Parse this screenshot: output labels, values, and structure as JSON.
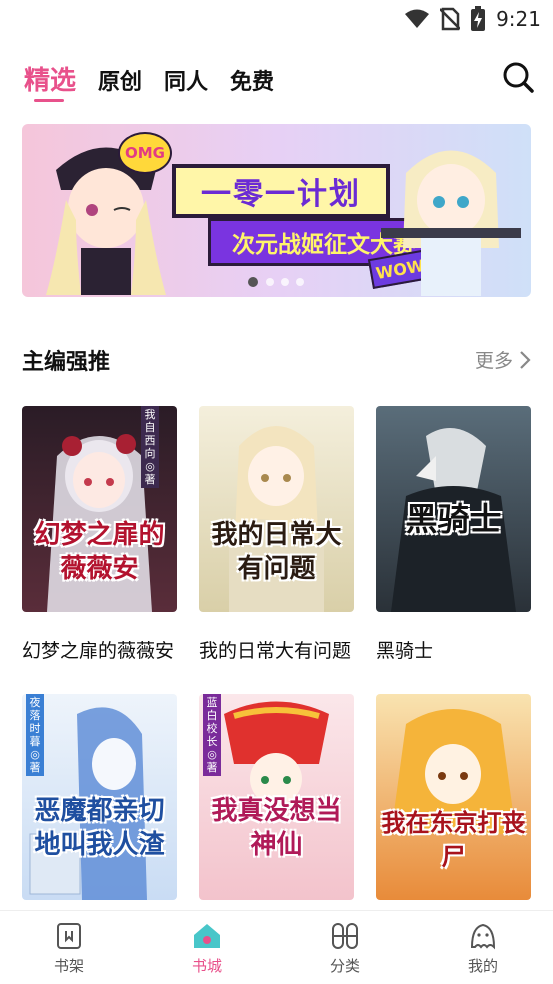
{
  "status": {
    "time": "9:21"
  },
  "tabs": [
    {
      "label": "精选",
      "active": true
    },
    {
      "label": "原创",
      "active": false
    },
    {
      "label": "同人",
      "active": false
    },
    {
      "label": "免费",
      "active": false
    }
  ],
  "banner": {
    "title": "一零一计划",
    "subtitle": "次元战姬征文大赛",
    "badge_omg": "OMG",
    "badge_wow": "WOW",
    "page_count": 4,
    "active_page": 1
  },
  "section": {
    "title": "主编强推",
    "more_label": "更多"
  },
  "books": [
    {
      "name": "幻梦之扉的薇薇安",
      "cover_text": "幻梦之扉的薇薇安",
      "author_tag": "我自西向◎著",
      "bg": "#3b2a33"
    },
    {
      "name": "我的日常大有问题",
      "cover_text": "我的日常大有问题",
      "author_tag": "",
      "bg": "#e9e2c8"
    },
    {
      "name": "黑骑士",
      "cover_text": "黑骑士",
      "author_tag": "",
      "bg": "#3c4a55"
    },
    {
      "name": "",
      "cover_text": "恶魔都亲切地叫我人渣",
      "author_tag": "夜落时暮◎著",
      "bg": "#dde9f8"
    },
    {
      "name": "",
      "cover_text": "我真没想当神仙",
      "author_tag": "蓝白校长◎著",
      "bg": "#f6d6dc"
    },
    {
      "name": "",
      "cover_text": "我在东京打丧尸",
      "author_tag": "",
      "bg": "#f3c77a"
    }
  ],
  "bottom_nav": [
    {
      "label": "书架",
      "icon": "bookshelf-icon",
      "active": false
    },
    {
      "label": "书城",
      "icon": "bookstore-home-icon",
      "active": true
    },
    {
      "label": "分类",
      "icon": "category-icon",
      "active": false
    },
    {
      "label": "我的",
      "icon": "profile-icon",
      "active": false
    }
  ],
  "colors": {
    "accent": "#e8518b",
    "text": "#111111",
    "muted": "#888888"
  }
}
